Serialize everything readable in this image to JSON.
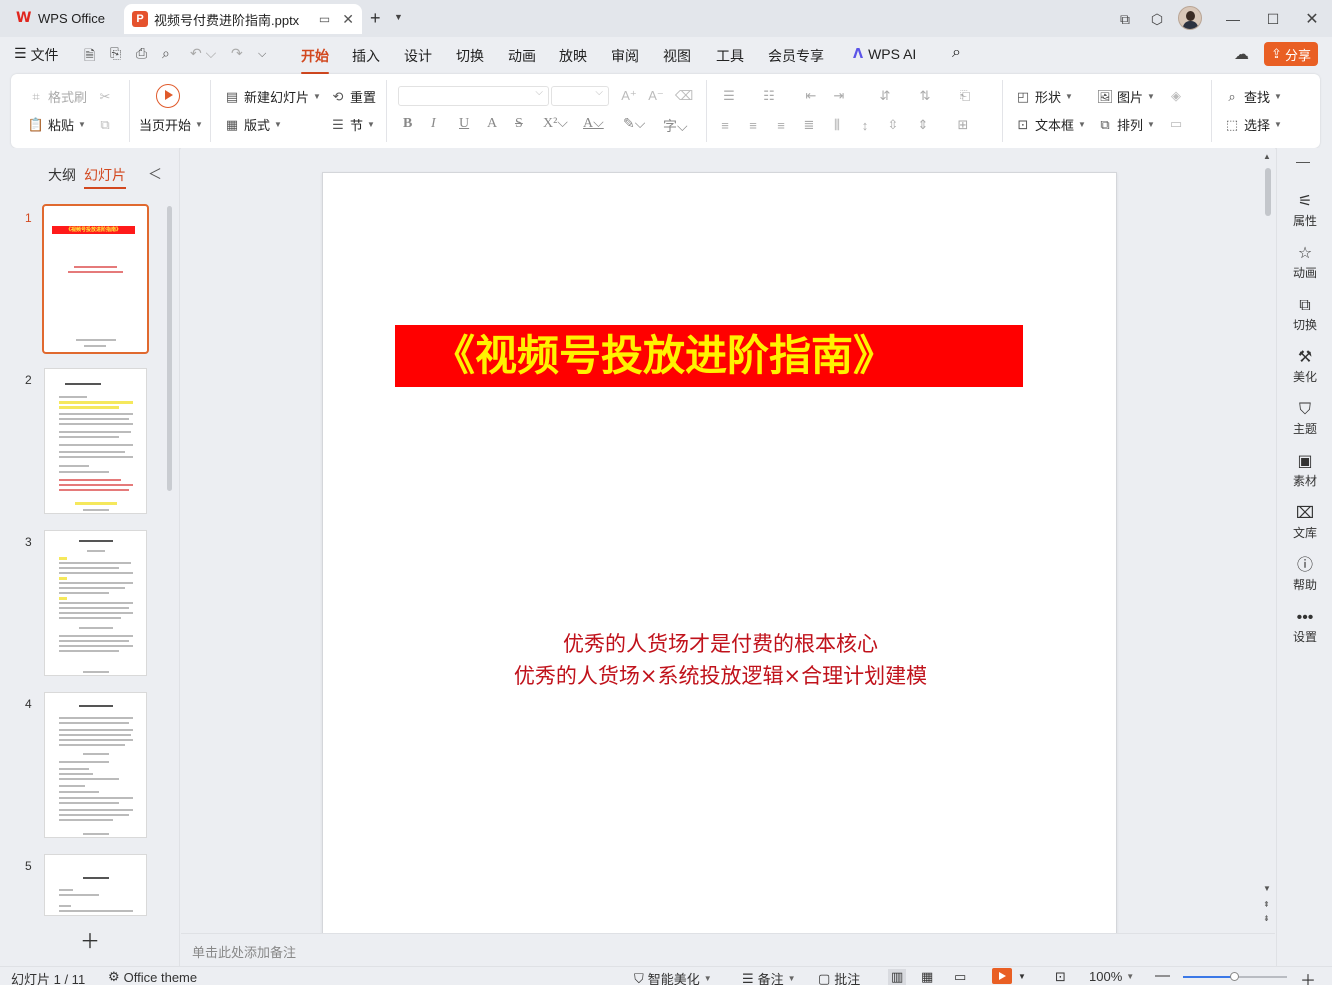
{
  "titlebar": {
    "app_name": "WPS Office",
    "doc_tab": "视频号付费进阶指南.pptx",
    "new_tab": "+",
    "window_controls": [
      "restore-icon",
      "3d-icon",
      "minimize-icon",
      "maximize-icon",
      "close-icon"
    ]
  },
  "menubar": {
    "file": "文件",
    "tabs": [
      "开始",
      "插入",
      "设计",
      "切换",
      "动画",
      "放映",
      "审阅",
      "视图",
      "工具",
      "会员专享"
    ],
    "active_tab": "开始",
    "wps_ai": "WPS AI",
    "share": "分享"
  },
  "ribbon": {
    "format_painter": "格式刷",
    "paste": "粘贴",
    "from_current": "当页开始",
    "new_slide": "新建幻灯片",
    "layout": "版式",
    "reset": "重置",
    "section": "节",
    "shape": "形状",
    "picture": "图片",
    "textbox": "文本框",
    "arrange": "排列",
    "find": "查找",
    "select": "选择"
  },
  "left_panel": {
    "tab_outline": "大纲",
    "tab_slides": "幻灯片",
    "slide_numbers": [
      "1",
      "2",
      "3",
      "4",
      "5"
    ],
    "active_slide": 1,
    "thumb1_title": "《视频号投放进阶指南》"
  },
  "slide": {
    "title": "《视频号投放进阶指南》",
    "subtitle_line1": "优秀的人货场才是付费的根本核心",
    "subtitle_line2": "优秀的人货场×系统投放逻辑×合理计划建模",
    "colors": {
      "title_bg": "#ff0000",
      "title_text": "#fff200",
      "subtitle_text": "#c0121b"
    }
  },
  "notes": {
    "placeholder": "单击此处添加备注"
  },
  "right_sidebar": {
    "items": [
      "属性",
      "动画",
      "切换",
      "美化",
      "主题",
      "素材",
      "文库",
      "帮助",
      "设置"
    ]
  },
  "statusbar": {
    "slide_counter": "幻灯片 1 / 11",
    "theme": "Office theme",
    "smart_beautify": "智能美化",
    "notes": "备注",
    "comments": "批注",
    "zoom": "100%",
    "zoom_level": 0.5
  },
  "accent_color": "#d2481f"
}
